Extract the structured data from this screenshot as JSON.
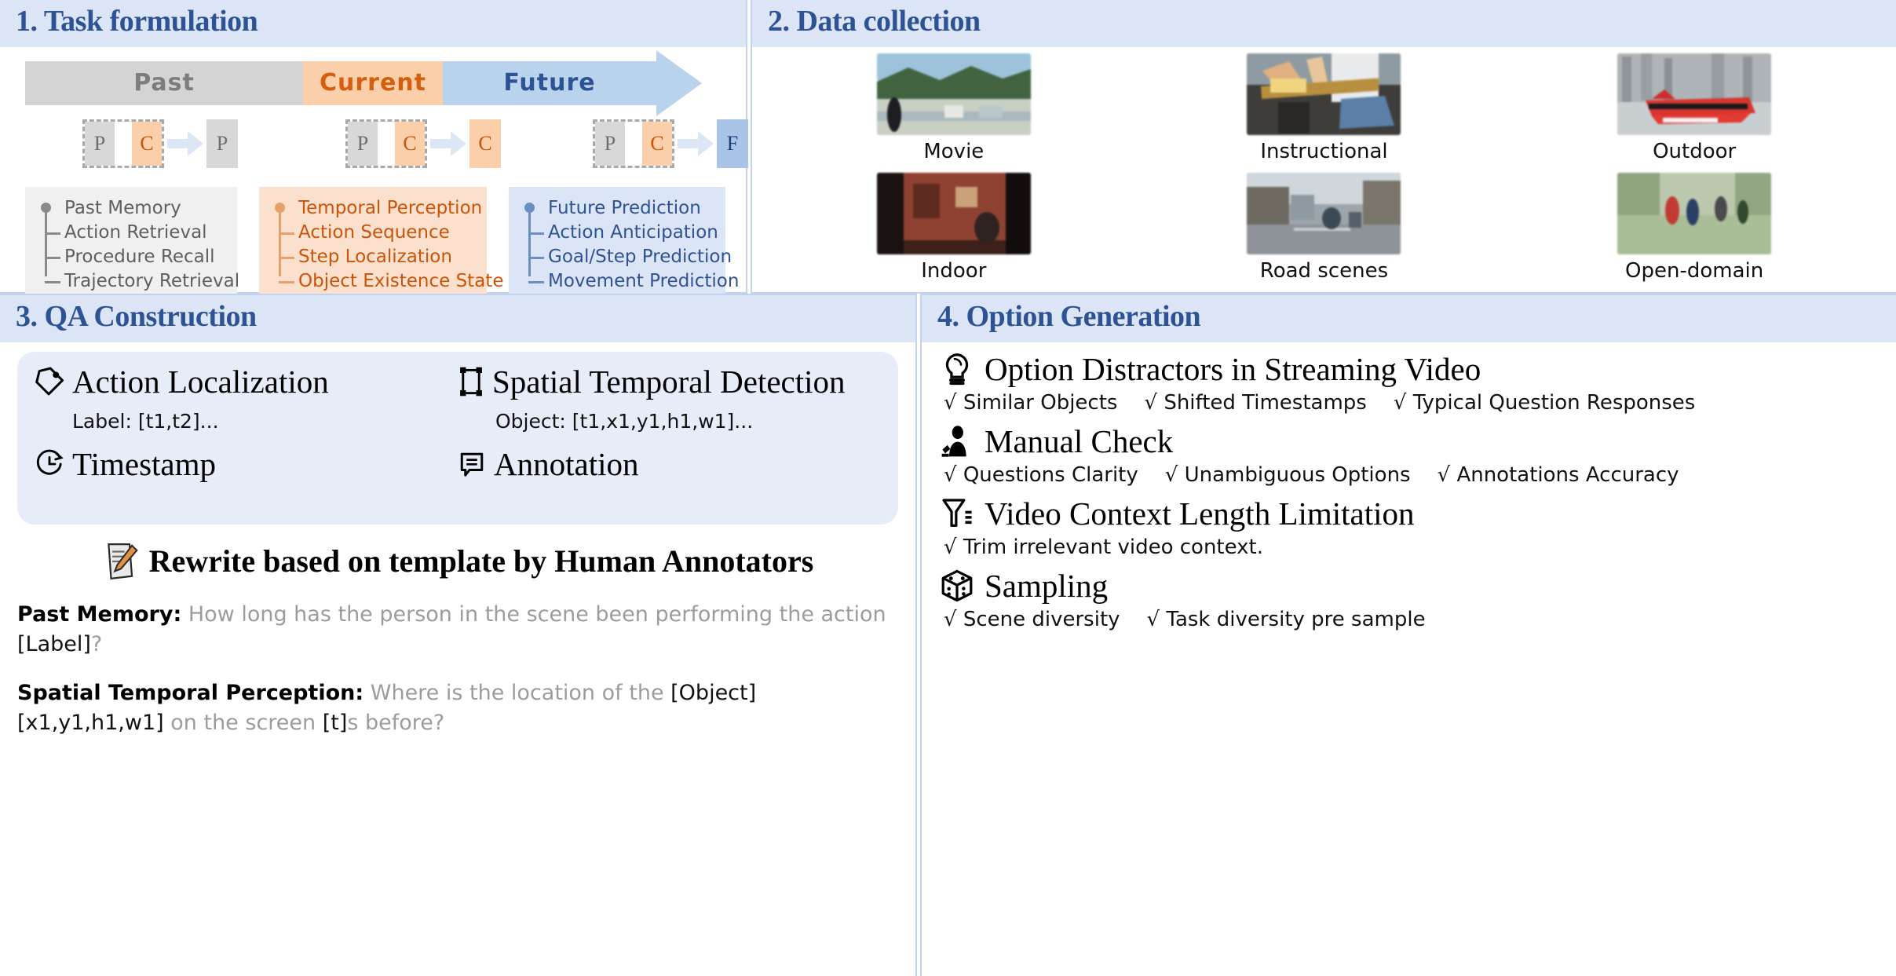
{
  "panels": {
    "p1": {
      "title": "1. Task formulation",
      "timeline": [
        {
          "label": "Past",
          "color": "#d4d4d4"
        },
        {
          "label": "Current",
          "color": "#fbcfa9"
        },
        {
          "label": "Future",
          "color": "#b9d3ec"
        }
      ],
      "diagrams": [
        {
          "input": [
            "P",
            "C"
          ],
          "output": "P"
        },
        {
          "input": [
            "P",
            "C"
          ],
          "output": "C"
        },
        {
          "input": [
            "P",
            "C"
          ],
          "output": "F"
        }
      ],
      "lists": [
        {
          "head": "Past Memory",
          "items": [
            "Action Retrieval",
            "Procedure Recall",
            "Trajectory Retrieval"
          ],
          "more": "......"
        },
        {
          "head": "Temporal Perception",
          "items": [
            "Action Sequence",
            "Step Localization",
            "Object Existence State"
          ],
          "more": "......"
        },
        {
          "head": "Future Prediction",
          "items": [
            "Action Anticipation",
            "Goal/Step Prediction",
            "Movement Prediction"
          ],
          "more": "......"
        }
      ]
    },
    "p2": {
      "title": "2. Data collection",
      "images": [
        {
          "caption": "Movie"
        },
        {
          "caption": "Instructional"
        },
        {
          "caption": "Outdoor"
        },
        {
          "caption": "Indoor"
        },
        {
          "caption": "Road scenes"
        },
        {
          "caption": "Open-domain"
        }
      ]
    },
    "p3": {
      "title": "3. QA Construction",
      "anno": {
        "left": [
          {
            "icon": "tag-icon",
            "title": "Action Localization",
            "sub": "Label: [t1,t2]..."
          },
          {
            "icon": "clock-icon",
            "title": "Timestamp",
            "sub": ""
          }
        ],
        "right": [
          {
            "icon": "bounding-box-icon",
            "title": "Spatial Temporal Detection",
            "sub": "Object: [t1,x1,y1,h1,w1]..."
          },
          {
            "icon": "comment-icon",
            "title": "Annotation",
            "sub": ""
          }
        ]
      },
      "rewrite_title": "Rewrite based on template by Human Annotators",
      "examples": [
        {
          "label": "Past Memory:",
          "pre": " How long has the person in the scene been performing the action ",
          "slot": "[Label]",
          "post": "?"
        },
        {
          "label": "Spatial Temporal Perception:",
          "pre": " Where is the location of the ",
          "slot1": "[Object]",
          "slot2": "[x1,y1,h1,w1]",
          "mid": " on the screen ",
          "slot3": "[t]",
          "post": "s before?"
        }
      ]
    },
    "p4": {
      "title": "4. Option Generation",
      "groups": [
        {
          "icon": "lightbulb-icon",
          "title": "Option Distractors in Streaming Video",
          "checks": [
            "Similar Objects",
            "Shifted Timestamps",
            "Typical Question Responses"
          ]
        },
        {
          "icon": "person-check-icon",
          "title": "Manual Check",
          "checks": [
            "Questions Clarity",
            "Unambiguous Options",
            "Annotations Accuracy"
          ]
        },
        {
          "icon": "funnel-icon",
          "title": "Video Context Length Limitation",
          "checks": [
            "Trim irrelevant video context."
          ]
        },
        {
          "icon": "dice-icon",
          "title": "Sampling",
          "checks": [
            "Scene diversity",
            "Task diversity pre sample"
          ]
        }
      ],
      "check_mark": "√"
    }
  },
  "colors": {
    "header_bg": "#dce5f5",
    "title_blue": "#2e5395",
    "past_gray": "#d4d4d4",
    "current_orange": "#fbcfa9",
    "future_blue": "#b9d3ec",
    "orange_text": "#c9540a",
    "gray_text": "#5f5f5f",
    "panel_border": "#c3d3ee"
  }
}
